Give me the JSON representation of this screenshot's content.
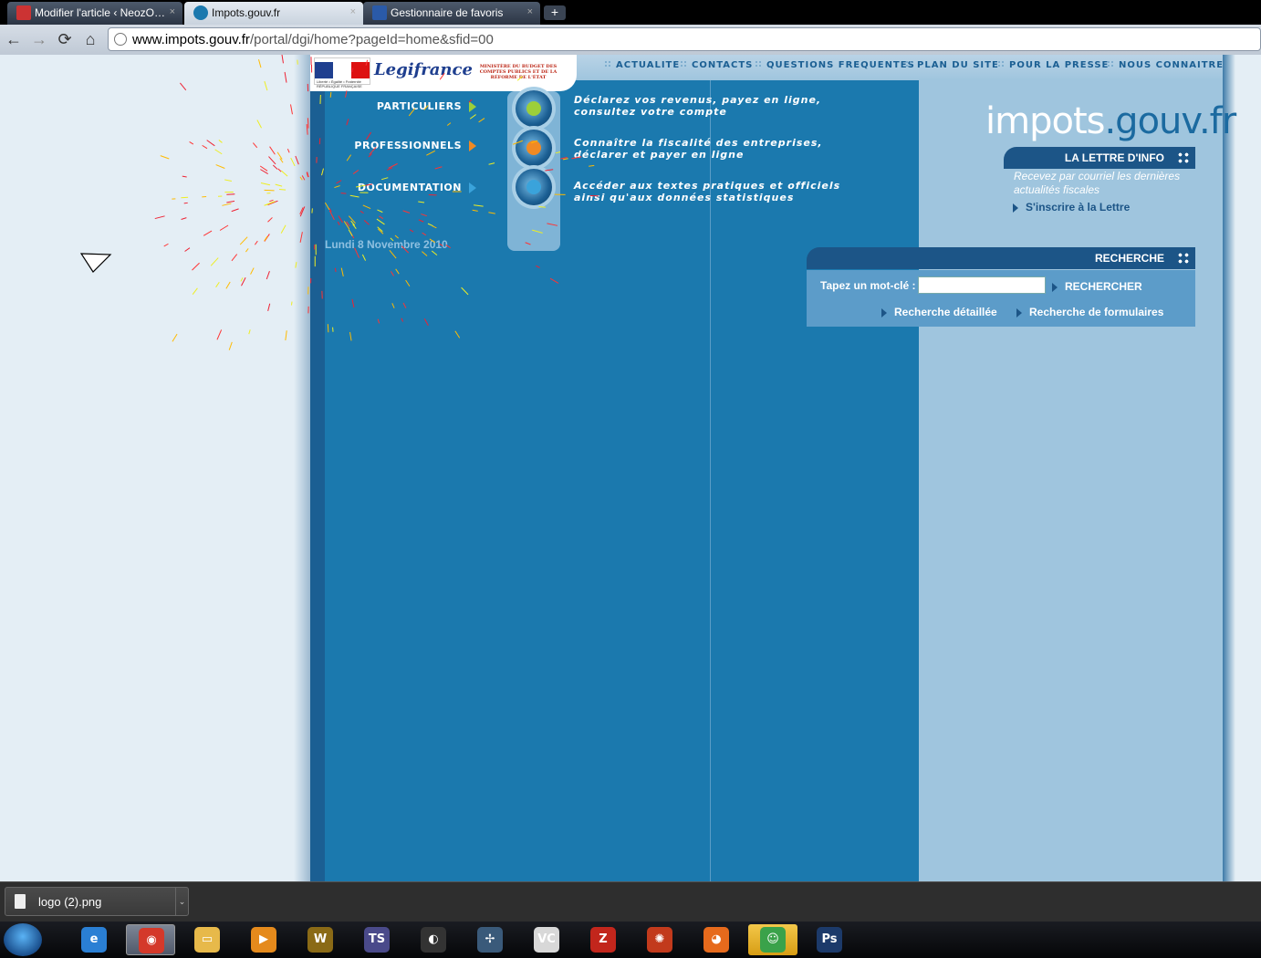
{
  "browser": {
    "tabs": [
      {
        "title": "Modifier l'article ‹ NeozO…",
        "active": false
      },
      {
        "title": "Impots.gouv.fr",
        "active": true
      },
      {
        "title": "Gestionnaire de favoris",
        "active": false
      }
    ],
    "tab_close_glyph": "×",
    "new_tab_glyph": "+",
    "url_domain": "www.impots.gouv.fr",
    "url_path": "/portal/dgi/home?pageId=home&sfid=00",
    "nav_glyphs": {
      "back": "←",
      "forward": "→",
      "reload": "⟳",
      "home": "⌂"
    }
  },
  "site": {
    "top_nav": [
      "ACTUALITE",
      "CONTACTS",
      "QUESTIONS FREQUENTES",
      "PLAN DU SITE",
      "POUR LA PRESSE",
      "NOUS CONNAITRE"
    ],
    "logo": {
      "legifrance": "Legifrance",
      "republique": "Liberté • Égalité • Fraternité RÉPUBLIQUE FRANÇAISE",
      "ministere": "MINISTÈRE DU BUDGET DES COMPTES PUBLICS ET DE LA RÉFORME DE L'ÉTAT"
    },
    "main_items": [
      {
        "label": "PARTICULIERS",
        "desc_line1": "Déclarez vos revenus, payez en ligne,",
        "desc_line2": "consultez votre compte",
        "color": "#9ccf3a"
      },
      {
        "label": "PROFESSIONNELS",
        "desc_line1": "Connaître la fiscalité des entreprises,",
        "desc_line2": "déclarer et payer en ligne",
        "color": "#f08a24"
      },
      {
        "label": "DOCUMENTATION",
        "desc_line1": "Accéder aux textes pratiques et officiels",
        "desc_line2": "ainsi qu'aux données statistiques",
        "color": "#3aa3db"
      }
    ],
    "date": "Lundi 8 Novembre 2010",
    "title_part1": "impots",
    "title_part2": ".gouv.fr",
    "newsletter": {
      "header": "LA LETTRE D'INFO",
      "text": "Recevez par courriel les dernières actualités fiscales",
      "link": "S'inscrire à la Lettre"
    },
    "search": {
      "header": "RECHERCHE",
      "label": "Tapez un mot-clé :",
      "input_value": "",
      "button": "RECHERCHER",
      "detailed": "Recherche détaillée",
      "forms": "Recherche de formulaires"
    }
  },
  "download_bar": {
    "file": "logo (2).png",
    "dropdown_glyph": "⌄"
  },
  "taskbar": {
    "items": [
      {
        "name": "internet-explorer-icon",
        "glyph": "e",
        "color": "#2a7fd4"
      },
      {
        "name": "chrome-icon",
        "glyph": "◉",
        "color": "#d4392a"
      },
      {
        "name": "explorer-folder-icon",
        "glyph": "▭",
        "color": "#e7b94a"
      },
      {
        "name": "media-player-icon",
        "glyph": "▶",
        "color": "#e58a1c"
      },
      {
        "name": "world-of-warcraft-icon",
        "glyph": "W",
        "color": "#8a6a16"
      },
      {
        "name": "teamspeak-icon",
        "glyph": "TS",
        "color": "#4a4a8a"
      },
      {
        "name": "steam-icon",
        "glyph": "◐",
        "color": "#333"
      },
      {
        "name": "starcraft-icon",
        "glyph": "✢",
        "color": "#3a5a7a"
      },
      {
        "name": "vnc-icon",
        "glyph": "VC",
        "color": "#d8d8d8"
      },
      {
        "name": "filezilla-icon",
        "glyph": "Z",
        "color": "#c2261c"
      },
      {
        "name": "burner-icon",
        "glyph": "✺",
        "color": "#c23a1c"
      },
      {
        "name": "firefox-icon",
        "glyph": "◕",
        "color": "#e66a1c"
      },
      {
        "name": "messenger-icon",
        "glyph": "☺",
        "color": "#3aa24a"
      },
      {
        "name": "photoshop-icon",
        "glyph": "Ps",
        "color": "#1c3a6a"
      }
    ]
  }
}
